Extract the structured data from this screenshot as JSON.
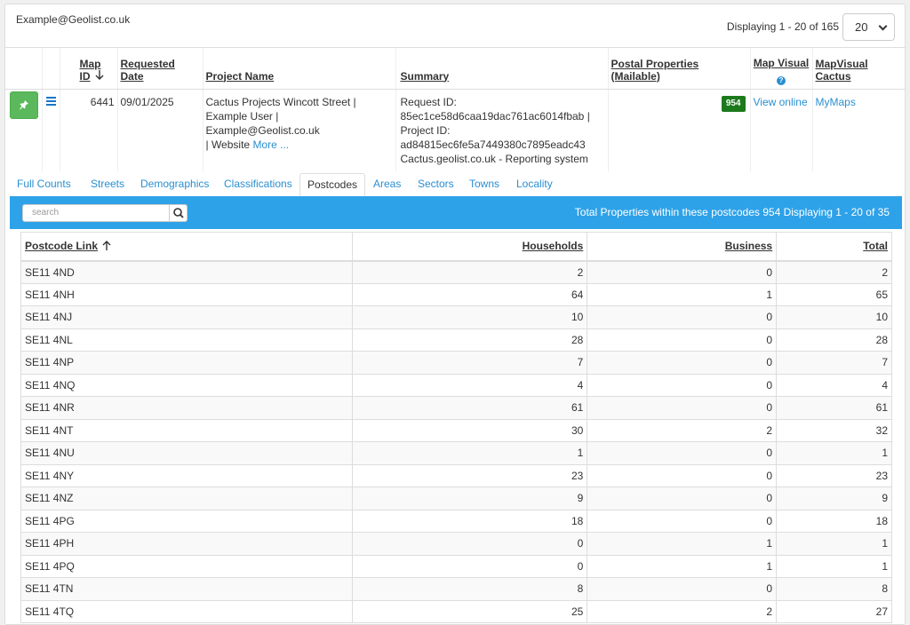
{
  "header": {
    "user_email": "Example@Geolist.co.uk",
    "display_info": "Displaying 1 - 20 of 165",
    "page_size": "20"
  },
  "request_table": {
    "columns": {
      "map_id": "Map ID",
      "requested_date": "Requested Date",
      "project_name": "Project Name",
      "summary": "Summary",
      "postal_properties": "Postal Properties (Mailable)",
      "map_visual": "Map Visual",
      "map_visual_cactus": "MapVisual Cactus"
    },
    "row": {
      "map_id": "6441",
      "requested_date": "09/01/2025",
      "project_name_line1": "Cactus Projects Wincott Street |",
      "project_name_line2": "Example User | Example@Geolist.co.uk",
      "project_name_line3": "| Website",
      "more_link": "More ...",
      "summary_line1": "Request ID:",
      "summary_line2": "85ec1ce58d6caa19dac761ac6014fbab |",
      "summary_line3": "Project ID:",
      "summary_line4": "ad84815ec6fe5a7449380c7895eadc43",
      "summary_line5": "Cactus.geolist.co.uk - Reporting system",
      "postal_properties": "954",
      "map_visual_link": "View online",
      "map_visual_cactus_link": "MyMaps"
    }
  },
  "tabs": [
    "Full Counts",
    "Streets",
    "Demographics",
    "Classifications",
    "Postcodes",
    "Areas",
    "Sectors",
    "Towns",
    "Locality"
  ],
  "active_tab": "Postcodes",
  "postcodes_bar": {
    "search_placeholder": "search",
    "info": "Total Properties within these postcodes 954  Displaying 1 - 20 of 35"
  },
  "postcodes_table": {
    "columns": {
      "postcode": "Postcode Link",
      "households": "Households",
      "business": "Business",
      "total": "Total"
    },
    "rows": [
      {
        "postcode": "SE11 4ND",
        "households": "2",
        "business": "0",
        "total": "2"
      },
      {
        "postcode": "SE11 4NH",
        "households": "64",
        "business": "1",
        "total": "65"
      },
      {
        "postcode": "SE11 4NJ",
        "households": "10",
        "business": "0",
        "total": "10"
      },
      {
        "postcode": "SE11 4NL",
        "households": "28",
        "business": "0",
        "total": "28"
      },
      {
        "postcode": "SE11 4NP",
        "households": "7",
        "business": "0",
        "total": "7"
      },
      {
        "postcode": "SE11 4NQ",
        "households": "4",
        "business": "0",
        "total": "4"
      },
      {
        "postcode": "SE11 4NR",
        "households": "61",
        "business": "0",
        "total": "61"
      },
      {
        "postcode": "SE11 4NT",
        "households": "30",
        "business": "2",
        "total": "32"
      },
      {
        "postcode": "SE11 4NU",
        "households": "1",
        "business": "0",
        "total": "1"
      },
      {
        "postcode": "SE11 4NY",
        "households": "23",
        "business": "0",
        "total": "23"
      },
      {
        "postcode": "SE11 4NZ",
        "households": "9",
        "business": "0",
        "total": "9"
      },
      {
        "postcode": "SE11 4PG",
        "households": "18",
        "business": "0",
        "total": "18"
      },
      {
        "postcode": "SE11 4PH",
        "households": "0",
        "business": "1",
        "total": "1"
      },
      {
        "postcode": "SE11 4PQ",
        "households": "0",
        "business": "1",
        "total": "1"
      },
      {
        "postcode": "SE11 4TN",
        "households": "8",
        "business": "0",
        "total": "8"
      },
      {
        "postcode": "SE11 4TQ",
        "households": "25",
        "business": "2",
        "total": "27"
      }
    ]
  },
  "colors": {
    "accent": "#2ea2e8",
    "link": "#2a8fd0",
    "success": "#5cb85c",
    "badge": "#1c7a1c"
  }
}
